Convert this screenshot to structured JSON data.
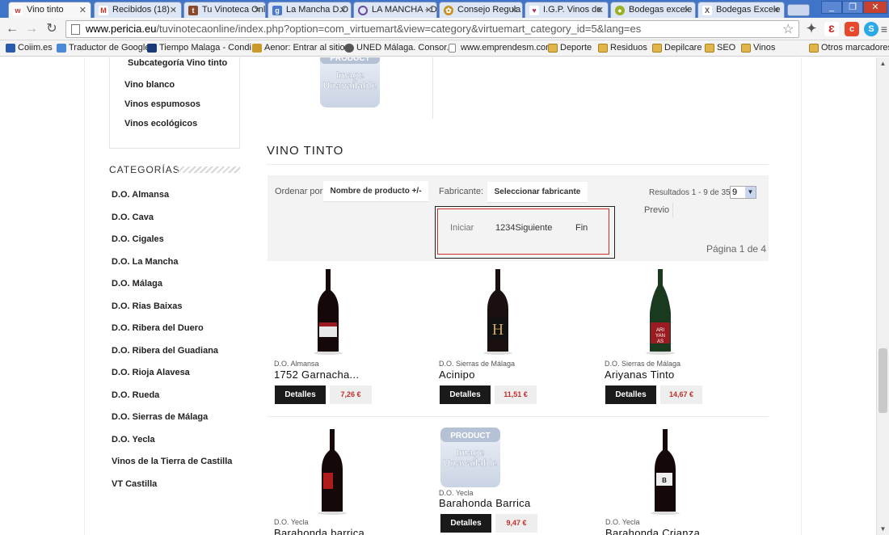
{
  "browser": {
    "tabs": [
      {
        "title": "Vino tinto",
        "icon": "w-logo-icon",
        "color": "#c0302a",
        "active": true
      },
      {
        "title": "Recibidos (18) -",
        "icon": "gmail-icon",
        "color": "#d93025",
        "active": false
      },
      {
        "title": "Tu Vinoteca Onl",
        "icon": "tuvinoteca-icon",
        "color": "#8a4a2a",
        "active": false
      },
      {
        "title": "La Mancha D.O",
        "icon": "google-icon",
        "color": "#4a78d0",
        "active": false
      },
      {
        "title": "LA MANCHA - D",
        "icon": "loading-icon",
        "color": "#6a4a9a",
        "active": false
      },
      {
        "title": "Consejo Regula",
        "icon": "consejo-icon",
        "color": "#c8901e",
        "active": false
      },
      {
        "title": "I.G.P. Vinos de",
        "icon": "igp-icon",
        "color": "#b0306a",
        "active": false
      },
      {
        "title": "Bodegas excele",
        "icon": "bodegas-icon",
        "color": "#9ab020",
        "active": false
      },
      {
        "title": "Bodegas Excele",
        "icon": "x-icon",
        "color": "#555555",
        "active": false
      }
    ],
    "url_host": "www.pericia.eu",
    "url_path": "/tuvinotecaonline/index.php?option=com_virtuemart&view=category&virtuemart_category_id=5&lang=es",
    "bookmarks": [
      {
        "label": "Coiim.es",
        "icon": "coiim-icon"
      },
      {
        "label": "Traductor de Google",
        "icon": "translate-icon"
      },
      {
        "label": "Tiempo Malaga - Condi...",
        "icon": "twc-icon"
      },
      {
        "label": "Aenor: Entrar al sitio",
        "icon": "aenor-icon"
      },
      {
        "label": "UNED Málaga. Consor...",
        "icon": "uned-icon"
      },
      {
        "label": "www.emprendesm.com",
        "icon": "page-icon"
      },
      {
        "label": "Deporte",
        "icon": "folder-icon"
      },
      {
        "label": "Residuos",
        "icon": "folder-icon"
      },
      {
        "label": "Depilcare",
        "icon": "folder-icon"
      },
      {
        "label": "SEO",
        "icon": "folder-icon"
      },
      {
        "label": "Vinos",
        "icon": "folder-icon"
      }
    ],
    "other_bookmarks": "Otros marcadores"
  },
  "sidebar": {
    "subcategory_items": [
      "Subcategoría Vino tinto",
      "Vino blanco",
      "Vinos espumosos",
      "Vinos ecológicos"
    ],
    "categories_title": "CATEGORÍAS",
    "categories": [
      "D.O. Almansa",
      "D.O. Cava",
      "D.O. Cigales",
      "D.O. La Mancha",
      "D.O. Málaga",
      "D.O. Rias Baixas",
      "D.O. Ribera del Duero",
      "D.O. Ribera del Guadiana",
      "D.O. Rioja Alavesa",
      "D.O. Rueda",
      "D.O. Sierras de Málaga",
      "D.O. Yecla",
      "Vinos de la Tierra de Castilla",
      "VT Castilla"
    ]
  },
  "placeholder_image": {
    "line1": "PRODUCT",
    "line2": "Image",
    "line3": "Unavailable"
  },
  "main": {
    "title": "VINO TINTO",
    "order_label": "Ordenar por",
    "order_button": "Nombre de producto +/-",
    "maker_label": "Fabricante:",
    "maker_button": "Seleccionar fabricante",
    "results": "Resultados 1 - 9 de 35",
    "per_page": "9",
    "prev": "Previo",
    "pager": {
      "start": "Iniciar",
      "pages": "1234Siguiente",
      "end": "Fin"
    },
    "page_info": "Página 1 de 4",
    "details_label": "Detalles"
  },
  "products": [
    {
      "maker": "D.O. Almansa",
      "name": "1752 Garnacha...",
      "price": "7,26 €",
      "bottle": "dark-label"
    },
    {
      "maker": "D.O. Sierras de Málaga",
      "name": "Acinipo",
      "price": "11,51 €",
      "bottle": "h-label"
    },
    {
      "maker": "D.O. Sierras de Málaga",
      "name": "Ariyanas Tinto",
      "price": "14,67 €",
      "bottle": "green-hock"
    },
    {
      "maker": "D.O. Yecla",
      "name": "Barahonda barrica",
      "price": "",
      "bottle": "red-label"
    },
    {
      "maker": "D.O. Yecla",
      "name": "Barahonda Barrica",
      "price": "9,47 €",
      "bottle": "placeholder"
    },
    {
      "maker": "D.O. Yecla",
      "name": "Barahonda Crianza",
      "price": "",
      "bottle": "white-label"
    }
  ]
}
